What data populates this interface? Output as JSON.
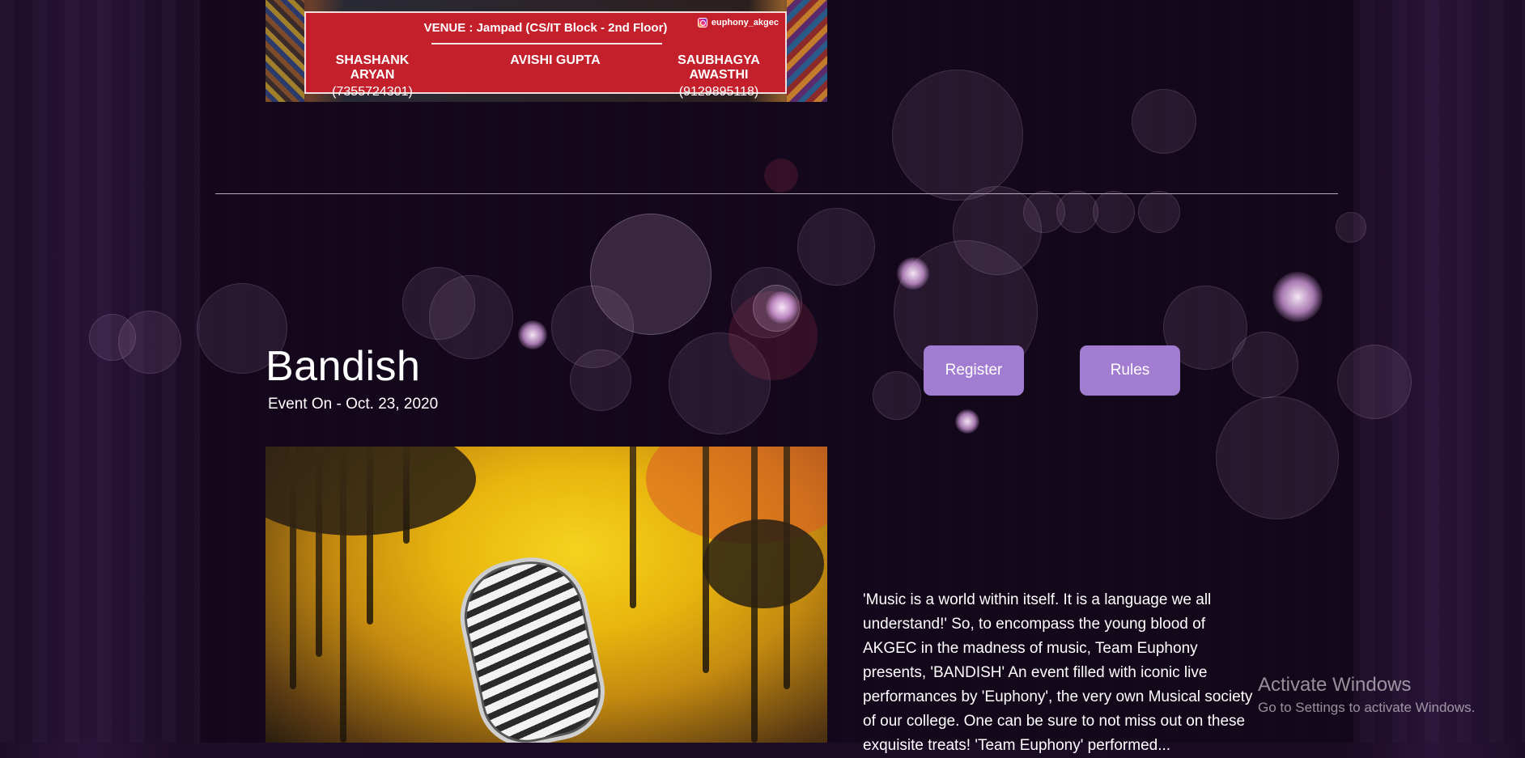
{
  "poster_top": {
    "venue": "VENUE : Jampad  (CS/IT Block - 2nd Floor)",
    "instagram": "euphony_akgec",
    "coordinators": [
      {
        "name": "SHASHANK ARYAN",
        "phone": "(7355724301)"
      },
      {
        "name": "AVISHI GUPTA",
        "phone": ""
      },
      {
        "name": "SAUBHAGYA AWASTHI",
        "phone": "(9129895118)"
      }
    ]
  },
  "event": {
    "title": "Bandish",
    "date": "Event On - Oct. 23, 2020",
    "register_label": "Register",
    "rules_label": "Rules",
    "description": "'Music is a world within itself. It is a language we all understand!' So, to encompass the young blood of AKGEC in the madness of music, Team Euphony presents, 'BANDISH' An event filled with iconic live performances by 'Euphony', the very own Musical society of our college. One can be sure to not miss out on these exquisite treats! 'Team Euphony' performed..."
  },
  "watermark": {
    "title": "Activate Windows",
    "subtitle": "Go to Settings to activate Windows."
  },
  "colors": {
    "button": "#a27cd0",
    "banner": "#c3202c",
    "background": "#1a0b24"
  }
}
